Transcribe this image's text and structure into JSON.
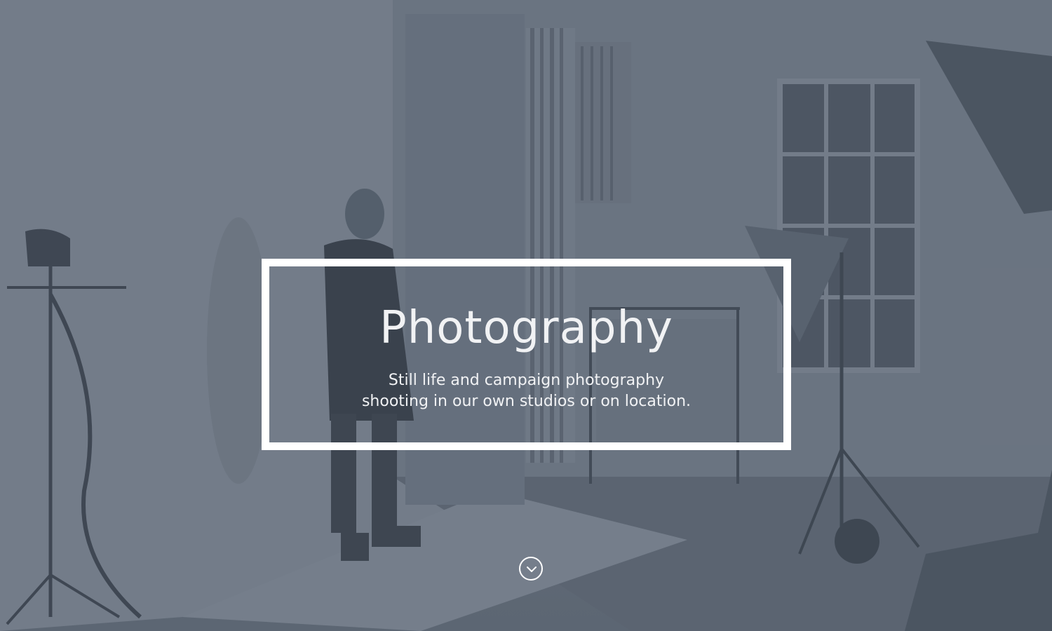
{
  "hero": {
    "title": "Photography",
    "subtitle_lines": [
      "Still life and campaign photography",
      "shooting in our own studios or on location."
    ],
    "background_image": "photo-studio-scene",
    "overlay_color": "#5a6472"
  },
  "scroll_button": {
    "icon": "chevron-down-icon"
  },
  "colors": {
    "text": "#f1f2f4",
    "frame": "#ffffff"
  }
}
